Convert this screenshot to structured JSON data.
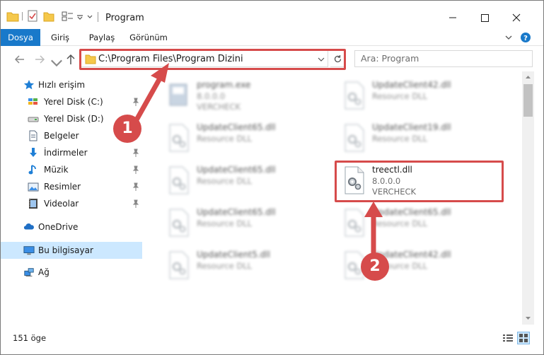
{
  "window": {
    "title": "Program"
  },
  "ribbon": {
    "tabs": [
      {
        "label": "Dosya",
        "active": true
      },
      {
        "label": "Giriş"
      },
      {
        "label": "Paylaş"
      },
      {
        "label": "Görünüm"
      }
    ]
  },
  "address": {
    "path": "C:\\Program Files\\Program Dizini"
  },
  "search": {
    "placeholder": "Ara: Program"
  },
  "sidebar": {
    "quick_access": "Hızlı erişim",
    "items": [
      {
        "label": "Yerel Disk (C:)",
        "icon": "drive-icon",
        "pinned": true
      },
      {
        "label": "Yerel Disk (D:)",
        "icon": "drive-icon",
        "pinned": false
      },
      {
        "label": "Belgeler",
        "icon": "documents-icon",
        "pinned": true
      },
      {
        "label": "İndirmeler",
        "icon": "downloads-icon",
        "pinned": true
      },
      {
        "label": "Müzik",
        "icon": "music-icon",
        "pinned": true
      },
      {
        "label": "Resimler",
        "icon": "pictures-icon",
        "pinned": true
      },
      {
        "label": "Videolar",
        "icon": "videos-icon",
        "pinned": true
      }
    ],
    "onedrive": "OneDrive",
    "this_pc": "Bu bilgisayar",
    "network": "Ağ"
  },
  "files": [
    {
      "name": "program.exe",
      "desc": "8.0.0.0",
      "sub": "VERCHECK"
    },
    {
      "name": "UpdateClient42.dll",
      "desc": "Resource DLL",
      "sub": ""
    },
    {
      "name": "UpdateClient65.dll",
      "desc": "Resource DLL",
      "sub": ""
    },
    {
      "name": "UpdateClient19.dll",
      "desc": "Resource DLL",
      "sub": ""
    },
    {
      "name": "UpdateClient65.dll",
      "desc": "Resource DLL",
      "sub": ""
    },
    {
      "name": "treectl.dll",
      "desc": "8.0.0.0",
      "sub": "VERCHECK"
    },
    {
      "name": "UpdateClient65.dll",
      "desc": "Resource DLL",
      "sub": ""
    },
    {
      "name": "UpdateClient65.dll",
      "desc": "Resource DLL",
      "sub": ""
    },
    {
      "name": "UpdateClient5.dll",
      "desc": "Resource DLL",
      "sub": ""
    },
    {
      "name": "UpdateClient42.dll",
      "desc": "Resource DLL",
      "sub": ""
    }
  ],
  "status": {
    "count": "151 öge"
  },
  "annotations": {
    "step1": "1",
    "step2": "2"
  },
  "colors": {
    "accent": "#1979ca",
    "highlight": "#d64b4b",
    "selected": "#cce8ff"
  }
}
